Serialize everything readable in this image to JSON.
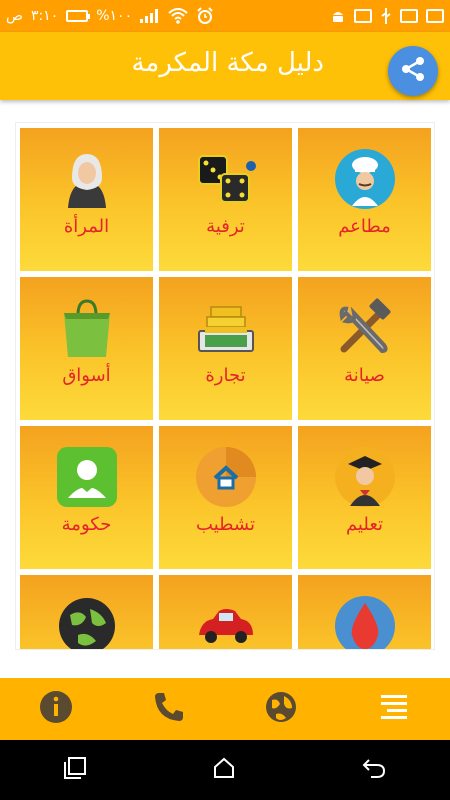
{
  "status_bar": {
    "time": "٣:١٠",
    "am_pm": "ص",
    "battery_percent": "%١٠٠"
  },
  "app_bar": {
    "title": "دليل مكة المكرمة",
    "share_icon": "share-icon"
  },
  "categories": [
    {
      "label": "مطاعم",
      "icon": "chef-icon"
    },
    {
      "label": "ترفية",
      "icon": "dice-icon"
    },
    {
      "label": "المرأة",
      "icon": "woman-icon"
    },
    {
      "label": "صيانة",
      "icon": "tools-icon"
    },
    {
      "label": "تجارة",
      "icon": "money-icon"
    },
    {
      "label": "أسواق",
      "icon": "shopping-bag-icon"
    },
    {
      "label": "تعليم",
      "icon": "graduate-icon"
    },
    {
      "label": "تشطيب",
      "icon": "home-finish-icon"
    },
    {
      "label": "حكومة",
      "icon": "government-icon"
    },
    {
      "label": "",
      "icon": "fuel-drop-icon"
    },
    {
      "label": "",
      "icon": "car-icon"
    },
    {
      "label": "",
      "icon": "globe-network-icon"
    }
  ],
  "bottom_bar": {
    "items": [
      "info-icon",
      "phone-icon",
      "globe-icon",
      "menu-icon"
    ]
  },
  "colors": {
    "accent": "#ffc107",
    "label": "#e5242a",
    "fab": "#4a8fe0"
  }
}
